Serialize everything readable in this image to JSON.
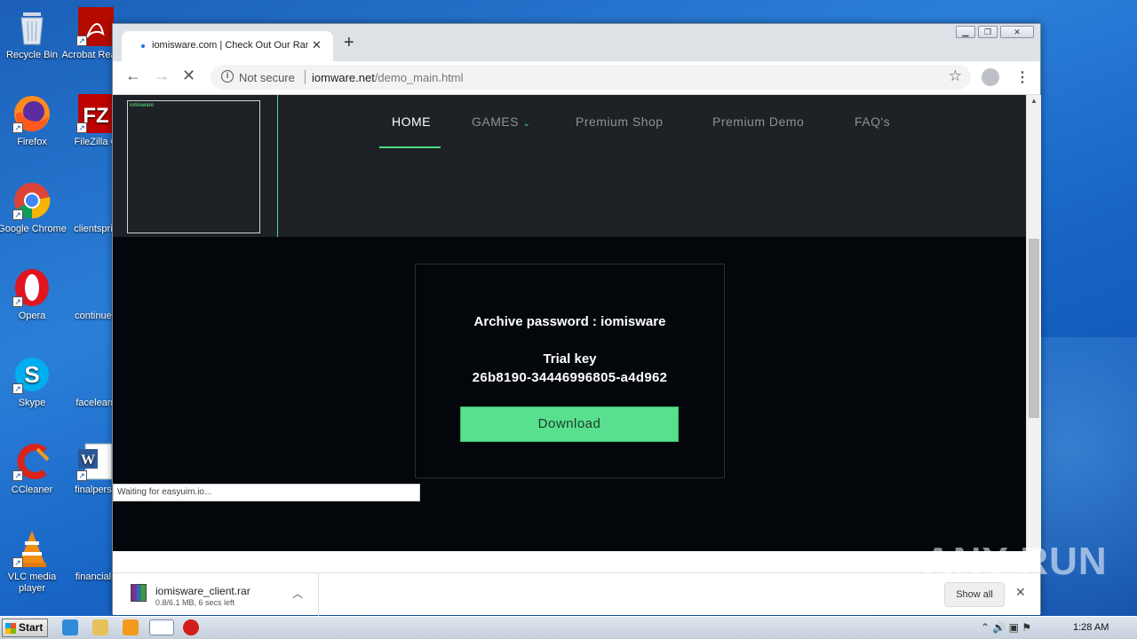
{
  "desktop": {
    "icons": [
      {
        "label": "Recycle Bin",
        "icon": "recycle-bin-icon"
      },
      {
        "label": "Acrobat Reader",
        "icon": "acrobat-icon"
      },
      {
        "label": "Firefox",
        "icon": "firefox-icon"
      },
      {
        "label": "FileZilla C",
        "icon": "filezilla-icon"
      },
      {
        "label": "Google Chrome",
        "icon": "chrome-icon"
      },
      {
        "label": "clientsprin",
        "icon": "file-icon"
      },
      {
        "label": "Opera",
        "icon": "opera-icon"
      },
      {
        "label": "continued",
        "icon": "file-icon"
      },
      {
        "label": "Skype",
        "icon": "skype-icon"
      },
      {
        "label": "facelearn",
        "icon": "file-icon"
      },
      {
        "label": "CCleaner",
        "icon": "ccleaner-icon"
      },
      {
        "label": "finalperso",
        "icon": "word-icon"
      },
      {
        "label": "VLC media player",
        "icon": "vlc-icon"
      },
      {
        "label": "financialp",
        "icon": "file-icon"
      }
    ]
  },
  "browser": {
    "tab_title": "iomisware.com | Check Out Our Ran",
    "new_tab": "+",
    "address": {
      "security_label": "Not secure",
      "host": "iomware.net",
      "path": "/demo_main.html"
    }
  },
  "site": {
    "logo_alt": "iomisware",
    "nav": [
      {
        "label": "HOME",
        "active": true
      },
      {
        "label": "GAMES",
        "has_dropdown": true
      },
      {
        "label": "Premium Shop"
      },
      {
        "label": "Premium Demo"
      },
      {
        "label": "FAQ's"
      }
    ],
    "card": {
      "archive_password": "Archive password : iomisware",
      "trial_key_label": "Trial key",
      "trial_key": "26b8190-34446996805-a4d962",
      "download_label": "Download"
    },
    "accent_color": "#4ddb87"
  },
  "status_text": "Waiting for easyuim.io...",
  "download_bar": {
    "file_name": "iomisware_client.rar",
    "status": "0.8/6.1 MB, 6 secs left",
    "show_all": "Show all"
  },
  "watermark": "ANY RUN",
  "taskbar": {
    "start_label": "Start",
    "time": "1:28 AM"
  }
}
